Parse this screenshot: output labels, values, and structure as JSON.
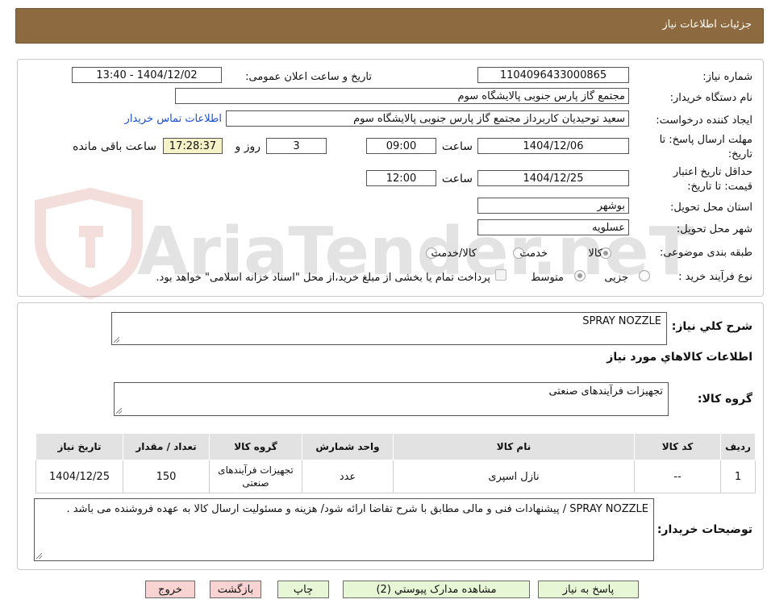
{
  "header": {
    "title": "جزئیات اطلاعات نیاز"
  },
  "form": {
    "need_number": {
      "label": "شماره نیاز:",
      "value": "1104096433000865"
    },
    "announce_datetime": {
      "label": "تاریخ و ساعت اعلان عمومی:",
      "value": "1404/12/02 - 13:40"
    },
    "buyer_org": {
      "label": "نام دستگاه خریدار:",
      "value": "مجتمع گاز پارس جنوبی  پالایشگاه سوم"
    },
    "requester": {
      "label": "ایجاد کننده درخواست:",
      "value": "سعید توحیدیان کاربرداز مجتمع گاز پارس جنوبی  پالایشگاه سوم"
    },
    "contact_link": "اطلاعات تماس خریدار",
    "reply_deadline": {
      "label_line1": "مهلت ارسال پاسخ: تا",
      "label_line2": "تاریخ:",
      "date": "1404/12/06",
      "time_label": "ساعت",
      "time": "09:00",
      "days": "3",
      "days_label": "روز و",
      "remaining": "17:28:37",
      "remaining_label": "ساعت باقی مانده"
    },
    "price_validity": {
      "label_line1": "حداقل تاریخ اعتبار",
      "label_line2": "قیمت: تا تاریخ:",
      "date": "1404/12/25",
      "time_label": "ساعت",
      "time": "12:00"
    },
    "province": {
      "label": "استان محل تحویل:",
      "value": "بوشهر"
    },
    "city": {
      "label": "شهر محل تحویل:",
      "value": "عسلویه"
    },
    "category": {
      "label": "طبقه بندی موضوعی:",
      "options": [
        "کالا",
        "خدمت",
        "کالا/خدمت"
      ],
      "selected": "کالا"
    },
    "process": {
      "label": "نوع فرآیند خرید :",
      "options": [
        "جزیی",
        "متوسط"
      ],
      "selected": "متوسط",
      "treasury_note": "پرداخت تمام یا بخشی از مبلغ خرید،از محل \"اسناد خزانه اسلامی\" خواهد بود."
    }
  },
  "watermark": {
    "text": "AriaTender.neT"
  },
  "details": {
    "general_desc_label": "شرح کلي نياز:",
    "general_desc": "SPRAY NOZZLE",
    "goods_info_title": "اطلاعات کالاهاي مورد نياز",
    "goods_group_label": "گروه کالا:",
    "goods_group": "تجهیزات فرآیندهای صنعتی",
    "table": {
      "headers": [
        "رديف",
        "کد کالا",
        "نام کالا",
        "واحد شمارش",
        "گروه کالا",
        "تعداد / مقدار",
        "تاريخ نياز"
      ],
      "rows": [
        [
          "1",
          "--",
          "نازل اسپری",
          "عدد",
          "تجهیزات فرآیندهای صنعتی",
          "150",
          "1404/12/25"
        ]
      ]
    },
    "buyer_notes_label": "توضيحات خريدار:",
    "buyer_notes": "SPRAY NOZZLE / پیشنهادات فنی و مالی مطابق با شرح تقاضا ارائه شود/ هزینه و مسئولیت ارسال کالا به عهده فروشنده می باشد ."
  },
  "buttons": {
    "reply": "پاسخ به نياز",
    "attachments": "مشاهده مدارک پيوستي (2)",
    "print": "چاپ",
    "back": "بازگشت",
    "exit": "خروج"
  },
  "colors": {
    "header_bg": "#8d6a3f",
    "green_button": "#e7f7d5",
    "red_button": "#f9d2d2",
    "link": "#1a4fd6",
    "remaining_bg": "#f6f2c8"
  }
}
